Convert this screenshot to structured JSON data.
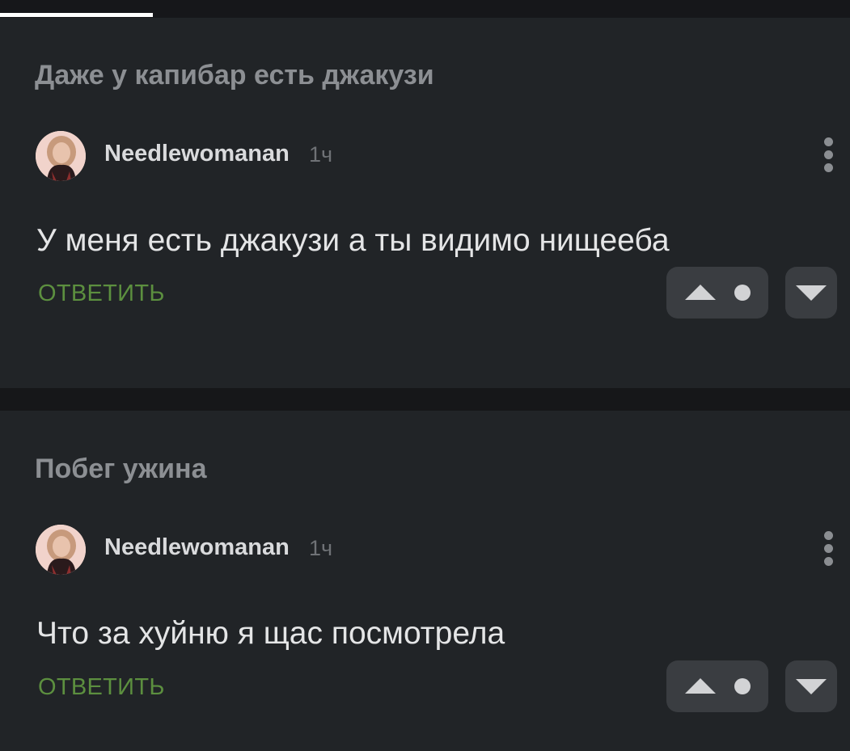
{
  "colors": {
    "background": "#212427",
    "reply_accent": "#5c8f3f",
    "title": "#8c8f93",
    "vote_button": "#3a3d41"
  },
  "posts": [
    {
      "title": "Даже у капибар есть джакузи",
      "comment": {
        "author": "Needlewomanan",
        "time": "1ч",
        "text": "У меня есть джакузи а ты видимо нищееба",
        "reply_label": "ОТВЕТИТЬ",
        "icons": [
          "avatar",
          "more-vertical-icon",
          "upvote-icon",
          "vote-dot-icon",
          "downvote-icon"
        ]
      }
    },
    {
      "title": "Побег ужина",
      "comment": {
        "author": "Needlewomanan",
        "time": "1ч",
        "text": "Что за хуйню я щас посмотрела",
        "reply_label": "ОТВЕТИТЬ",
        "icons": [
          "avatar",
          "more-vertical-icon",
          "upvote-icon",
          "vote-dot-icon",
          "downvote-icon"
        ]
      }
    }
  ]
}
